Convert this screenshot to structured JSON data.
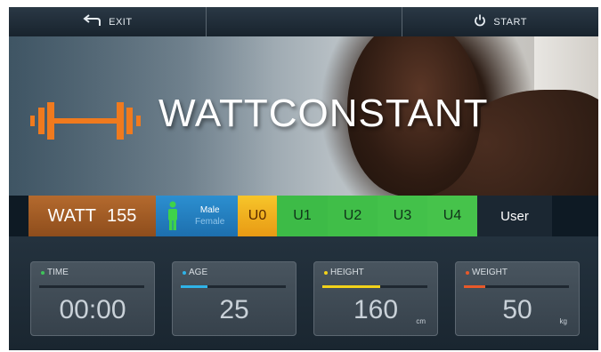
{
  "topbar": {
    "exit_label": "EXIT",
    "start_label": "START"
  },
  "hero": {
    "mode_title": "WATTCONSTANT"
  },
  "strip": {
    "watt_label": "WATT",
    "watt_value": "155",
    "gender_male": "Male",
    "gender_female": "Female",
    "presets": [
      "U0",
      "U1",
      "U2",
      "U3",
      "U4"
    ],
    "user_label": "User"
  },
  "readouts": [
    {
      "label": "TIME",
      "value": "00:00",
      "unit": "",
      "accent": "#3fc45a",
      "level": 0
    },
    {
      "label": "AGE",
      "value": "25",
      "unit": "",
      "accent": "#2fb3e8",
      "level": 0.25
    },
    {
      "label": "HEIGHT",
      "value": "160",
      "unit": "cm",
      "accent": "#f2d21a",
      "level": 0.55
    },
    {
      "label": "WEIGHT",
      "value": "50",
      "unit": "kg",
      "accent": "#e8592a",
      "level": 0.2
    }
  ],
  "colors": {
    "accent_orange": "#f07a1e",
    "watt_bg": "#a55f27",
    "gender_bg": "#2381c2",
    "preset_u0": "#f0b21e",
    "preset_green": "#40be48"
  },
  "icons": {
    "exit": "return-arrow-icon",
    "start": "power-icon",
    "mode": "dumbbell-icon",
    "gender": "person-icon"
  }
}
